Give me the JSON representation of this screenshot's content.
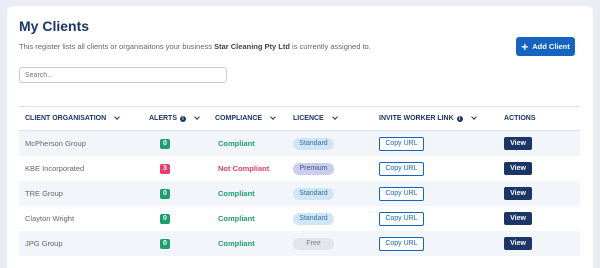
{
  "page": {
    "title": "My Clients",
    "description_prefix": "This register lists all clients or organisaitons your business ",
    "business_name": "Star Cleaning Pty Ltd",
    "description_suffix": " is currently assigned to.",
    "add_button_label": "Add Client",
    "search_placeholder": "Search..."
  },
  "table": {
    "headers": {
      "client": "CLIENT ORGANISATION",
      "alerts": "ALERTS",
      "compliance": "COMPLIANCE",
      "licence": "LICENCE",
      "invite": "INVITE WORKER LINK",
      "actions": "ACTIONS"
    },
    "rows": [
      {
        "client": "McPherson Group",
        "alerts": "0",
        "compliance": "Compliant",
        "licence": "Standard",
        "copy": "Copy URL",
        "view": "View"
      },
      {
        "client": "KBE Incorporated",
        "alerts": "3",
        "compliance": "Not Compliant",
        "licence": "Premium",
        "copy": "Copy URL",
        "view": "View"
      },
      {
        "client": "TRE Group",
        "alerts": "0",
        "compliance": "Compliant",
        "licence": "Standard",
        "copy": "Copy URL",
        "view": "View"
      },
      {
        "client": "Clayton Wright",
        "alerts": "0",
        "compliance": "Compliant",
        "licence": "Standard",
        "copy": "Copy URL",
        "view": "View"
      },
      {
        "client": "JPG Group",
        "alerts": "0",
        "compliance": "Compliant",
        "licence": "Free",
        "copy": "Copy URL",
        "view": "View"
      }
    ]
  },
  "colors": {
    "alert_ok": "#1e9e6e",
    "alert_warn": "#e83e6c",
    "compliant": "#1e9e6e",
    "not_compliant": "#e83e6c",
    "licence_standard_bg": "#cfe6f7",
    "licence_standard_fg": "#3a6fa0",
    "licence_premium_bg": "#c9cdee",
    "licence_premium_fg": "#4a4f8a",
    "licence_free_bg": "#e3e5ea",
    "licence_free_fg": "#7a7f8a"
  }
}
